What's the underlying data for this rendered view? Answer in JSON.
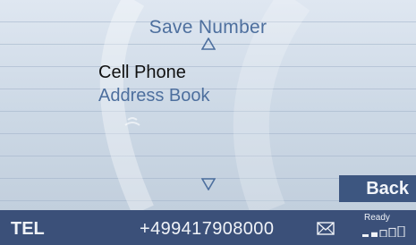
{
  "menu": {
    "title": "Save Number",
    "items": [
      "Cell Phone",
      "Address Book"
    ],
    "selected_index": 0,
    "back_label": "Back"
  },
  "status": {
    "mode_label": "TEL",
    "phone_number": "+499417908000",
    "ready_label": "Ready",
    "signal_bars_filled": 2,
    "signal_bars_total": 5
  },
  "icons": {
    "scroll_up": "triangle-up-icon",
    "scroll_down": "triangle-down-icon",
    "message": "envelope-icon",
    "signal": "signal-strength-icon"
  },
  "colors": {
    "accent_text": "#4d6f9e",
    "selected_text": "#111111",
    "status_bar": "#3b5079",
    "back_button": "#3d5680"
  }
}
